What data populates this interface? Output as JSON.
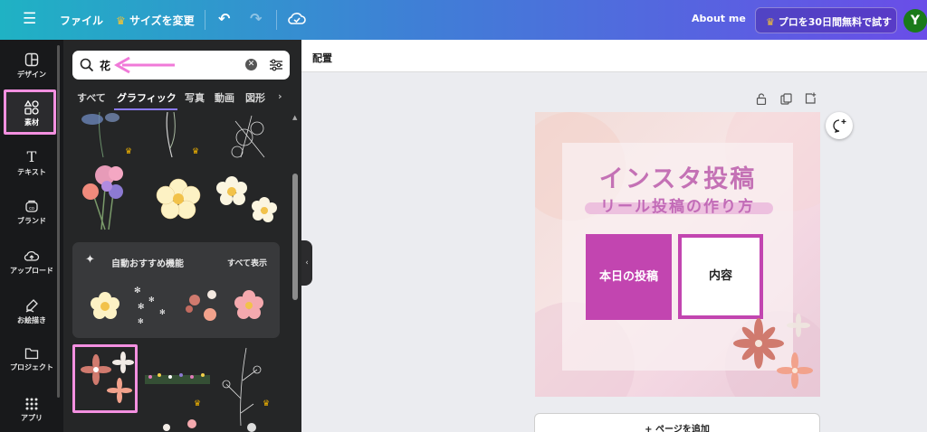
{
  "topbar": {
    "file_label": "ファイル",
    "resize_label": "サイズを変更",
    "about_label": "About me",
    "pro_label": "プロを30日間無料で試す",
    "avatar_initial": "Y"
  },
  "rail": {
    "items": [
      {
        "label": "デザイン",
        "icon": "design-icon"
      },
      {
        "label": "素材",
        "icon": "elements-icon"
      },
      {
        "label": "テキスト",
        "icon": "text-icon"
      },
      {
        "label": "ブランド",
        "icon": "brand-icon"
      },
      {
        "label": "アップロード",
        "icon": "upload-icon"
      },
      {
        "label": "お絵描き",
        "icon": "draw-icon"
      },
      {
        "label": "プロジェクト",
        "icon": "folder-icon"
      },
      {
        "label": "アプリ",
        "icon": "apps-icon"
      }
    ]
  },
  "panel": {
    "search_value": "花",
    "tabs": [
      "すべて",
      "グラフィック",
      "写真",
      "動画",
      "図形"
    ],
    "active_tab": "グラフィック",
    "recommend_title": "自動おすすめ機能",
    "recommend_all": "すべて表示"
  },
  "editor": {
    "toolbar_label": "配置",
    "design": {
      "title": "インスタ投稿",
      "subtitle": "リール投稿の作り方",
      "box1": "本日の投稿",
      "box2": "内容"
    },
    "add_page": "+ ページを追加"
  },
  "colors": {
    "accent": "#c245b0",
    "highlight": "#f390e0",
    "topbar_gradient": [
      "#1fb2c4",
      "#6a4de8"
    ]
  }
}
